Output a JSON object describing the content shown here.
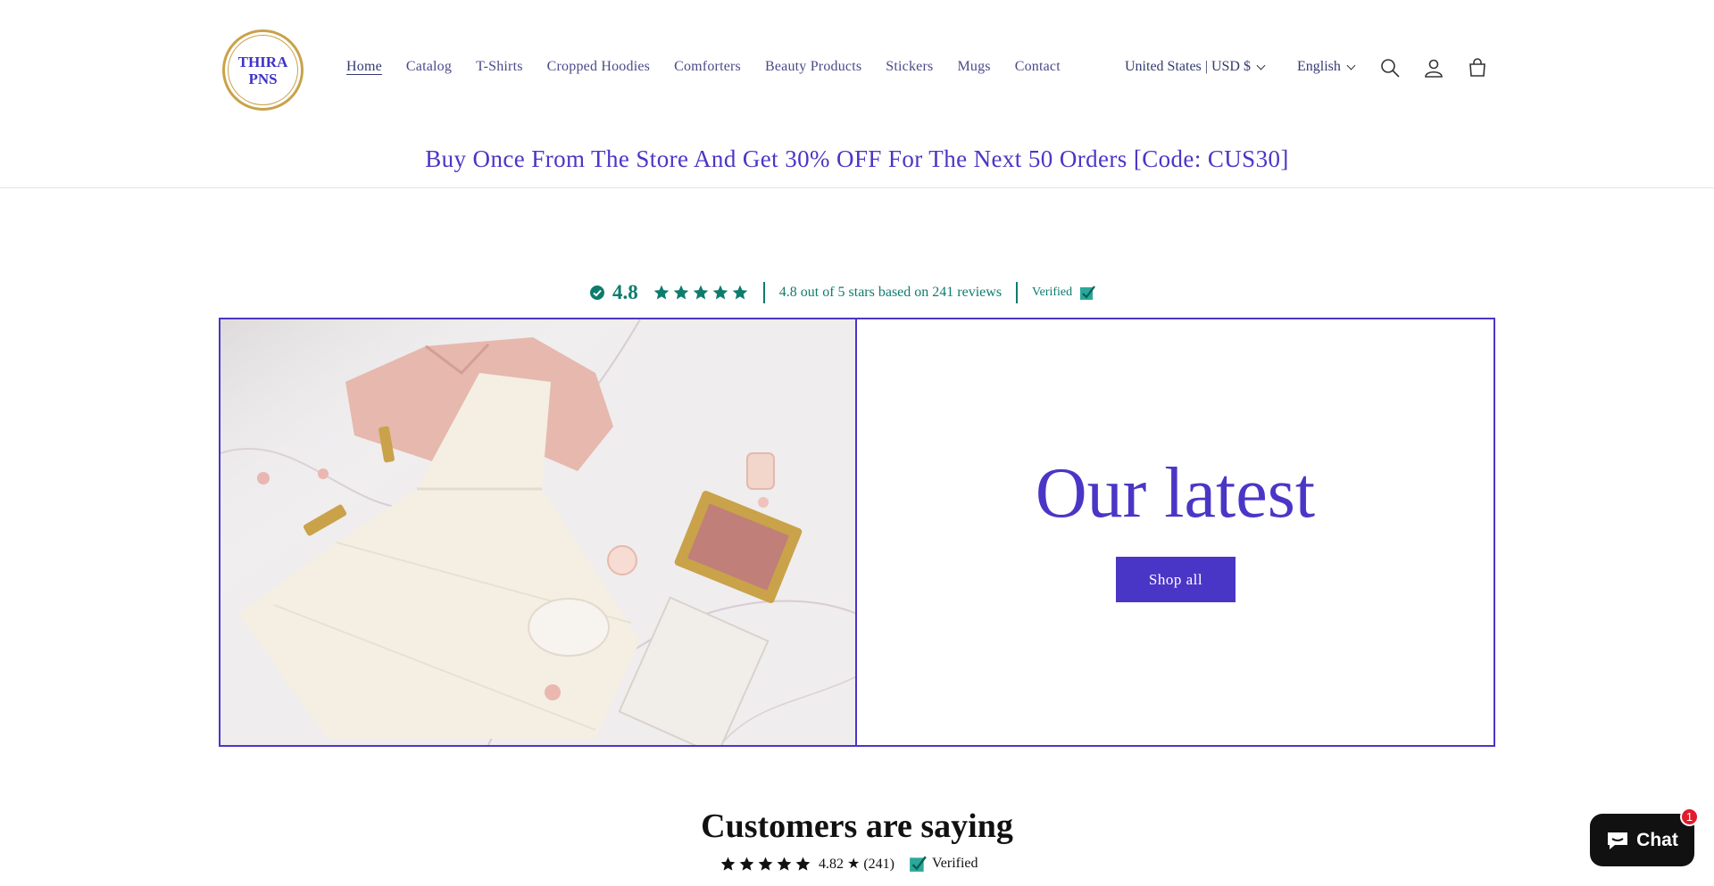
{
  "brand": {
    "logo_line1": "THIRA",
    "logo_line2": "PNS",
    "logo_color": "#3f33c7",
    "logo_ring_color": "#c9a24a"
  },
  "nav": {
    "items": [
      {
        "label": "Home",
        "active": true
      },
      {
        "label": "Catalog"
      },
      {
        "label": "T-Shirts"
      },
      {
        "label": "Cropped Hoodies"
      },
      {
        "label": "Comforters"
      },
      {
        "label": "Beauty Products"
      },
      {
        "label": "Stickers"
      },
      {
        "label": "Mugs"
      },
      {
        "label": "Contact"
      }
    ]
  },
  "locale": {
    "country": "United States | USD $",
    "language": "English"
  },
  "header_icons": [
    "search-icon",
    "account-icon",
    "cart-icon"
  ],
  "announcement": "Buy Once From The Store And Get 30% OFF For The Next 50 Orders [Code: CUS30]",
  "reviews_bar": {
    "score": "4.8",
    "summary": "4.8 out of 5 stars based on 241 reviews",
    "verified": "Verified",
    "color": "#0d7c6e"
  },
  "hero": {
    "title": "Our latest",
    "button": "Shop all",
    "accent": "#4a36c6"
  },
  "customers": {
    "title": "Customers are saying",
    "rating": "4.82 ★ (241)",
    "verified": "Verified"
  },
  "chat": {
    "label": "Chat",
    "badge": "1"
  }
}
